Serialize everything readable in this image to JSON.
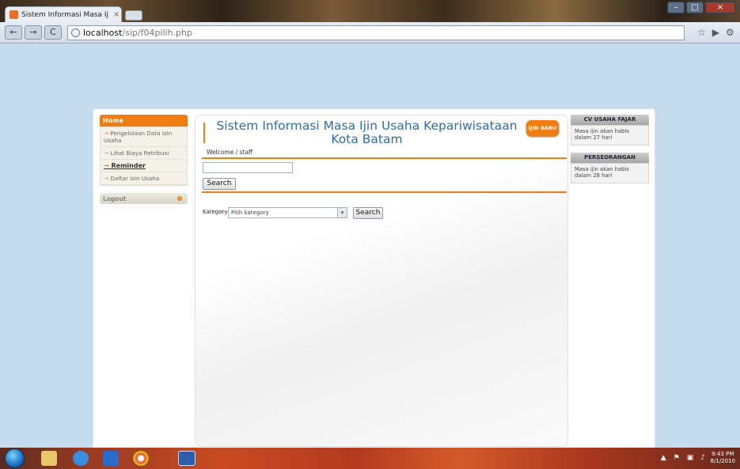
{
  "browser": {
    "tab_title": "Sistem Informasi Masa Ij...",
    "tab_close": "×",
    "url_host": "localhost",
    "url_path": "/sip/f04pilih.php",
    "back": "←",
    "forward": "→",
    "reload": "C"
  },
  "menu": {
    "home": "Home",
    "items": [
      {
        "label": "Pengelolaan Data Izin Usaha"
      },
      {
        "label": "Lihat Biaya Retribusi"
      },
      {
        "label": "Reminder"
      },
      {
        "label": "Daftar Izin Usaha"
      }
    ],
    "logout": "Logout"
  },
  "header": {
    "title": "Sistem Informasi Masa Ijin Usaha Kepariwisataan Kota Batam",
    "new_button": "IJIN BARU",
    "welcome": "Welcome / staff"
  },
  "search": {
    "value": "",
    "button": "Search"
  },
  "category": {
    "label": "Kategory",
    "selected": "Pilih kategory",
    "button": "Search"
  },
  "reminders": [
    {
      "title": "CV USAHA FAJAR",
      "text": "Masa ijin akan habis dalam 27 hari"
    },
    {
      "title": "PERSEORANGAN",
      "text": "Masa ijin akan habis dalam 28 hari"
    }
  ],
  "taskbar": {
    "time": "9:43 PM",
    "date": "8/1/2010"
  },
  "colors": {
    "accent": "#f07d12",
    "title": "#2e6ea8",
    "page_bg": "#c5dcef"
  }
}
